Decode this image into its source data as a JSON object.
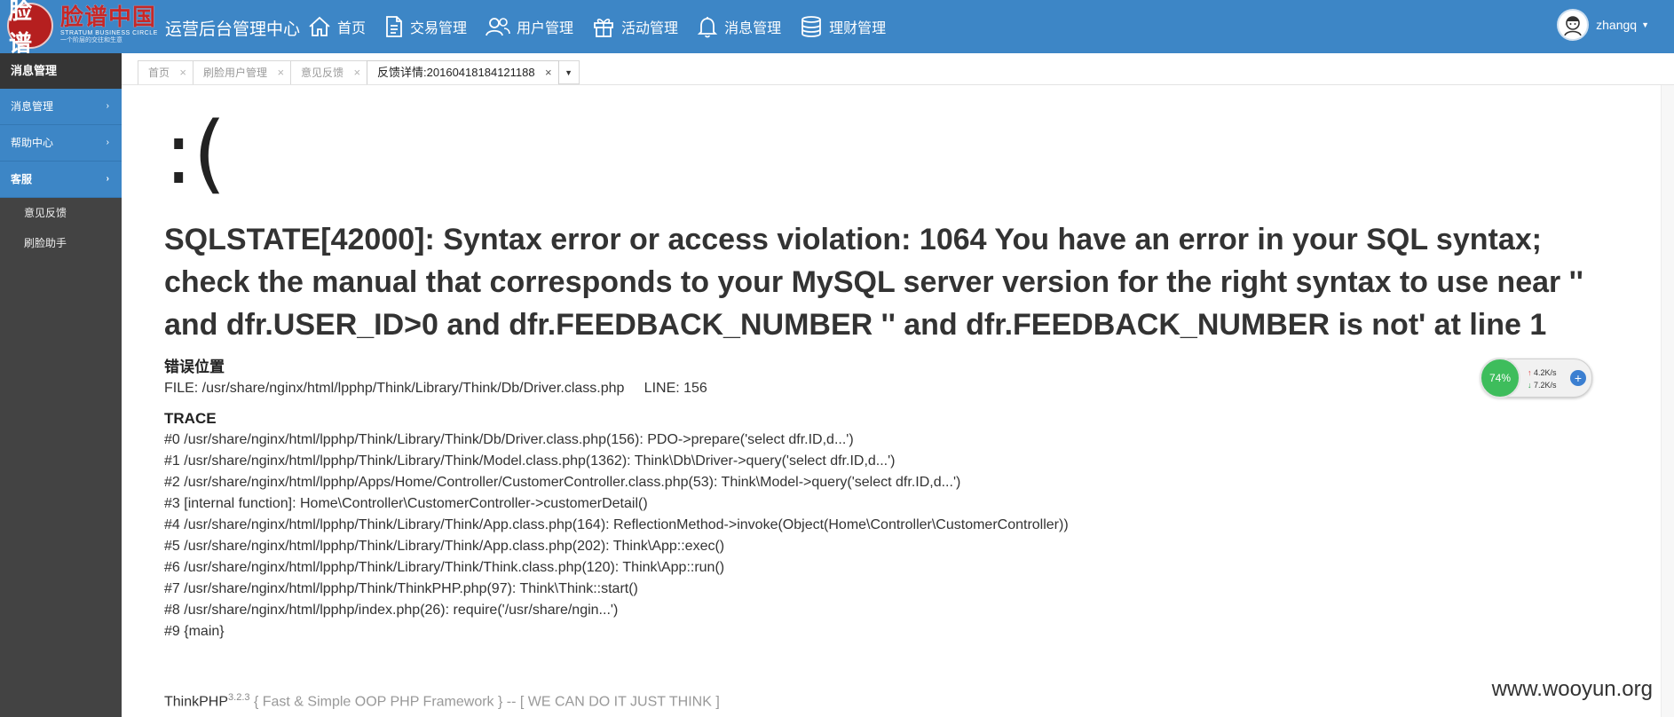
{
  "header": {
    "logo_seal": "脸谱",
    "logo_cn": "脸谱中国",
    "logo_en": "STRATUM BUSINESS CIRCLE",
    "logo_slogan": "一个阶层的交往和生意",
    "app_title": "运营后台管理中心",
    "nav": [
      {
        "label": "首页",
        "icon": "home-icon"
      },
      {
        "label": "交易管理",
        "icon": "document-icon"
      },
      {
        "label": "用户管理",
        "icon": "users-icon"
      },
      {
        "label": "活动管理",
        "icon": "gift-icon"
      },
      {
        "label": "消息管理",
        "icon": "bell-icon"
      },
      {
        "label": "理财管理",
        "icon": "database-icon"
      }
    ],
    "username": "zhangq"
  },
  "sidebar": {
    "heading": "消息管理",
    "items": [
      {
        "label": "消息管理"
      },
      {
        "label": "帮助中心"
      },
      {
        "label": "客服"
      }
    ],
    "subitems": [
      {
        "label": "意见反馈"
      },
      {
        "label": "刷脸助手"
      }
    ]
  },
  "tabs": [
    {
      "label": "首页"
    },
    {
      "label": "刷脸用户管理"
    },
    {
      "label": "意见反馈"
    },
    {
      "label": "反馈详情:20160418184121188"
    }
  ],
  "error": {
    "face": ":(",
    "message": "SQLSTATE[42000]: Syntax error or access violation: 1064 You have an error in your SQL syntax; check the manual that corresponds to your MySQL server version for the right syntax to use near '' and dfr.USER_ID>0 and dfr.FEEDBACK_NUMBER '' and dfr.FEEDBACK_NUMBER is not' at line 1",
    "location_label": "错误位置",
    "location": "FILE: /usr/share/nginx/html/lpphp/Think/Library/Think/Db/Driver.class.php     LINE: 156",
    "trace_label": "TRACE",
    "trace": [
      "#0 /usr/share/nginx/html/lpphp/Think/Library/Think/Db/Driver.class.php(156): PDO->prepare('select dfr.ID,d...')",
      "#1 /usr/share/nginx/html/lpphp/Think/Library/Think/Model.class.php(1362): Think\\Db\\Driver->query('select dfr.ID,d...')",
      "#2 /usr/share/nginx/html/lpphp/Apps/Home/Controller/CustomerController.class.php(53): Think\\Model->query('select dfr.ID,d...')",
      "#3 [internal function]: Home\\Controller\\CustomerController->customerDetail()",
      "#4 /usr/share/nginx/html/lpphp/Think/Library/Think/App.class.php(164): ReflectionMethod->invoke(Object(Home\\Controller\\CustomerController))",
      "#5 /usr/share/nginx/html/lpphp/Think/Library/Think/App.class.php(202): Think\\App::exec()",
      "#6 /usr/share/nginx/html/lpphp/Think/Library/Think/Think.class.php(120): Think\\App::run()",
      "#7 /usr/share/nginx/html/lpphp/Think/ThinkPHP.php(97): Think\\Think::start()",
      "#8 /usr/share/nginx/html/lpphp/index.php(26): require('/usr/share/ngin...')",
      "#9 {main}"
    ]
  },
  "footer": {
    "framework": "ThinkPHP",
    "version": "3.2.3",
    "slogan": " { Fast & Simple OOP PHP Framework } -- [ WE CAN DO IT JUST THINK ]"
  },
  "net_widget": {
    "percent": "74%",
    "up": "4.2K/s",
    "down": "7.2K/s"
  },
  "watermark": "www.wooyun.org",
  "colors": {
    "topbar": "#3d86c6",
    "sidebar": "#434343"
  }
}
